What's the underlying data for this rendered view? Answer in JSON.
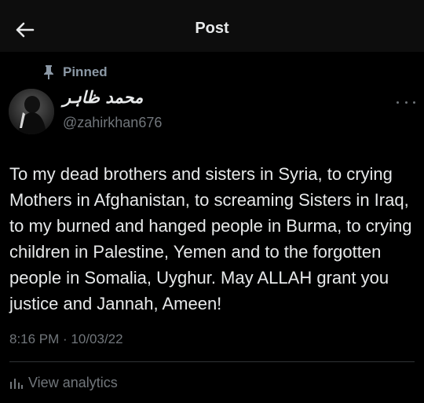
{
  "header": {
    "title": "Post"
  },
  "pinned_label": "Pinned",
  "author": {
    "display_name": "محمد ظاہر",
    "handle": "@zahirkhan676"
  },
  "post": {
    "text": "To my dead brothers and sisters in Syria, to crying Mothers in Afghanistan, to screaming Sisters in Iraq, to my burned and hanged people in Burma, to crying children in Palestine, Yemen and to the forgotten people in Somalia, Uyghur. May ALLAH grant you justice and Jannah, Ameen!",
    "timestamp": "8:16 PM · 10/03/22"
  },
  "actions": {
    "view_analytics": "View analytics"
  },
  "icons": {
    "back": "back-arrow-icon",
    "pin": "pin-icon",
    "more": "more-icon",
    "analytics": "analytics-icon"
  },
  "colors": {
    "background": "#000000",
    "header_background": "#0d0d0d",
    "primary_text": "#e7e9ea",
    "secondary_text": "#71767b",
    "divider": "#2f3336"
  }
}
